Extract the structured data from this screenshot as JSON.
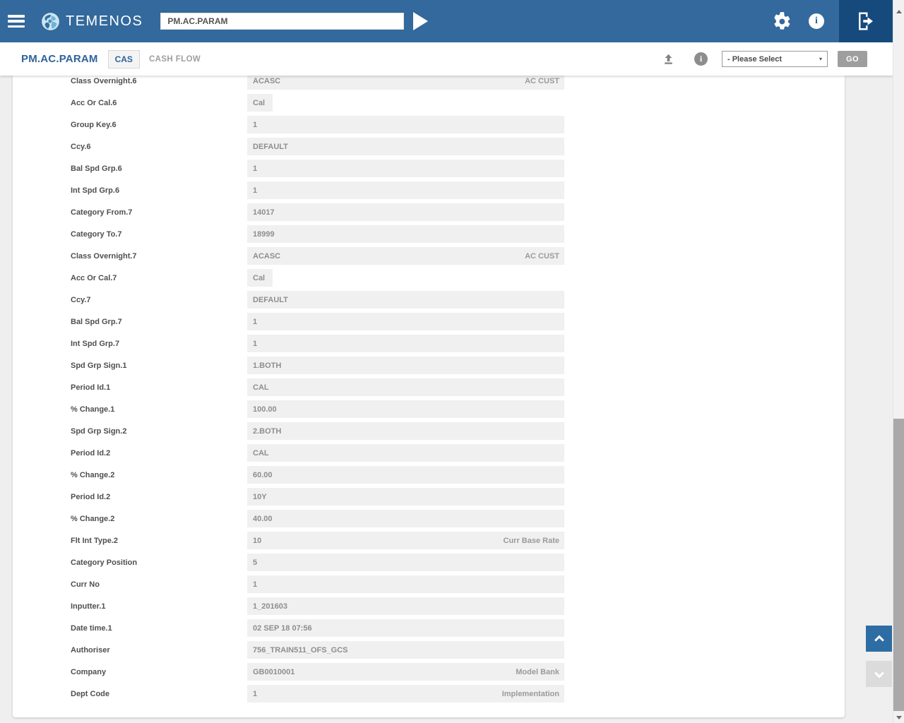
{
  "colors": {
    "header_bg": "#33699C",
    "header_dark_bg": "#164A7C",
    "accent_blue": "#2D639B",
    "page_bg": "#EFEFEF",
    "value_bg": "#F0F0F0",
    "label_color": "#4F4F4F",
    "value_color": "#8E8E8E",
    "enrich_color": "#9A9A9A",
    "go_bg": "#9E9E9E",
    "scroll_thumb": "#A9A9A9",
    "btn_up_bg": "#2E6DA4",
    "btn_down_bg": "#DBDBDB"
  },
  "icons": {
    "hamburger": "menu bars",
    "globe": "temenos globe logo",
    "play": "white right triangle",
    "gear": "settings gear",
    "info_header": "white circle with blue i",
    "exit": "door with right arrow",
    "upload": "up arrow over bar",
    "info_toolbar": "gray circle with white i",
    "caret_down": "▾",
    "chevron_up": "white chevron up",
    "chevron_down": "white chevron down"
  },
  "header": {
    "brand": "TEMENOS",
    "command_value": "PM.AC.PARAM"
  },
  "toolbar": {
    "title": "PM.AC.PARAM",
    "tab": "CAS",
    "subtitle": "CASH FLOW",
    "select_value": "- Please Select",
    "go_label": "GO",
    "info_glyph": "i"
  },
  "header_info_glyph": "i",
  "form": {
    "rows": [
      {
        "label": "Class Overnight.6",
        "value": "ACASC",
        "enrichment": "AC CUST"
      },
      {
        "label": "Acc Or Cal.6",
        "value": "Cal",
        "short": true
      },
      {
        "label": "Group Key.6",
        "value": "1"
      },
      {
        "label": "Ccy.6",
        "value": "DEFAULT"
      },
      {
        "label": "Bal Spd Grp.6",
        "value": "1"
      },
      {
        "label": "Int Spd Grp.6",
        "value": "1"
      },
      {
        "label": "Category From.7",
        "value": "14017"
      },
      {
        "label": "Category To.7",
        "value": "18999"
      },
      {
        "label": "Class Overnight.7",
        "value": "ACASC",
        "enrichment": "AC CUST"
      },
      {
        "label": "Acc Or Cal.7",
        "value": "Cal",
        "short": true
      },
      {
        "label": "Ccy.7",
        "value": "DEFAULT"
      },
      {
        "label": "Bal Spd Grp.7",
        "value": "1"
      },
      {
        "label": "Int Spd Grp.7",
        "value": "1"
      },
      {
        "label": "Spd Grp Sign.1",
        "value": "1.BOTH"
      },
      {
        "label": "Period Id.1",
        "value": "CAL"
      },
      {
        "label": "% Change.1",
        "value": "100.00"
      },
      {
        "label": "Spd Grp Sign.2",
        "value": "2.BOTH"
      },
      {
        "label": "Period Id.2",
        "value": "CAL"
      },
      {
        "label": "% Change.2",
        "value": "60.00"
      },
      {
        "label": "Period Id.2",
        "value": "10Y"
      },
      {
        "label": "% Change.2",
        "value": "40.00"
      },
      {
        "label": "Flt Int Type.2",
        "value": "10",
        "enrichment": "Curr Base Rate"
      },
      {
        "label": "Category Position",
        "value": "5"
      },
      {
        "label": "Curr No",
        "value": "1"
      },
      {
        "label": "Inputter.1",
        "value": "1_201603"
      },
      {
        "label": "Date time.1",
        "value": "02 SEP 18 07:56"
      },
      {
        "label": "Authoriser",
        "value": "756_TRAIN511_OFS_GCS"
      },
      {
        "label": "Company",
        "value": "GB0010001",
        "enrichment": "Model Bank"
      },
      {
        "label": "Dept Code",
        "value": "1",
        "enrichment": "Implementation"
      }
    ]
  }
}
